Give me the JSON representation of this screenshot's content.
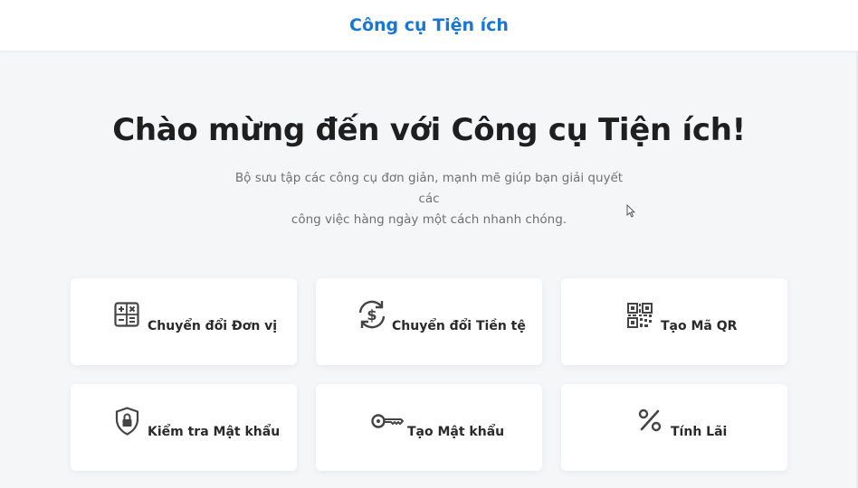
{
  "header": {
    "brand": "Công cụ Tiện ích"
  },
  "hero": {
    "title": "Chào mừng đến với Công cụ Tiện ích!",
    "subtitle_line1": "Bộ sưu tập các công cụ đơn giản, mạnh mẽ giúp bạn giải quyết các",
    "subtitle_line2": "công việc hàng ngày một cách nhanh chóng."
  },
  "tools": [
    {
      "label": "Chuyển đổi Đơn vị",
      "icon": "calculator-icon"
    },
    {
      "label": "Chuyển đổi Tiền tệ",
      "icon": "currency-exchange-icon"
    },
    {
      "label": "Tạo Mã QR",
      "icon": "qr-code-icon"
    },
    {
      "label": "Kiểm tra Mật khẩu",
      "icon": "shield-lock-icon"
    },
    {
      "label": "Tạo Mật khẩu",
      "icon": "key-icon"
    },
    {
      "label": "Tính Lãi",
      "icon": "percent-icon"
    }
  ],
  "colors": {
    "brand": "#1976d2",
    "background": "#f5f6f8",
    "card": "#ffffff",
    "icon": "#444444"
  }
}
